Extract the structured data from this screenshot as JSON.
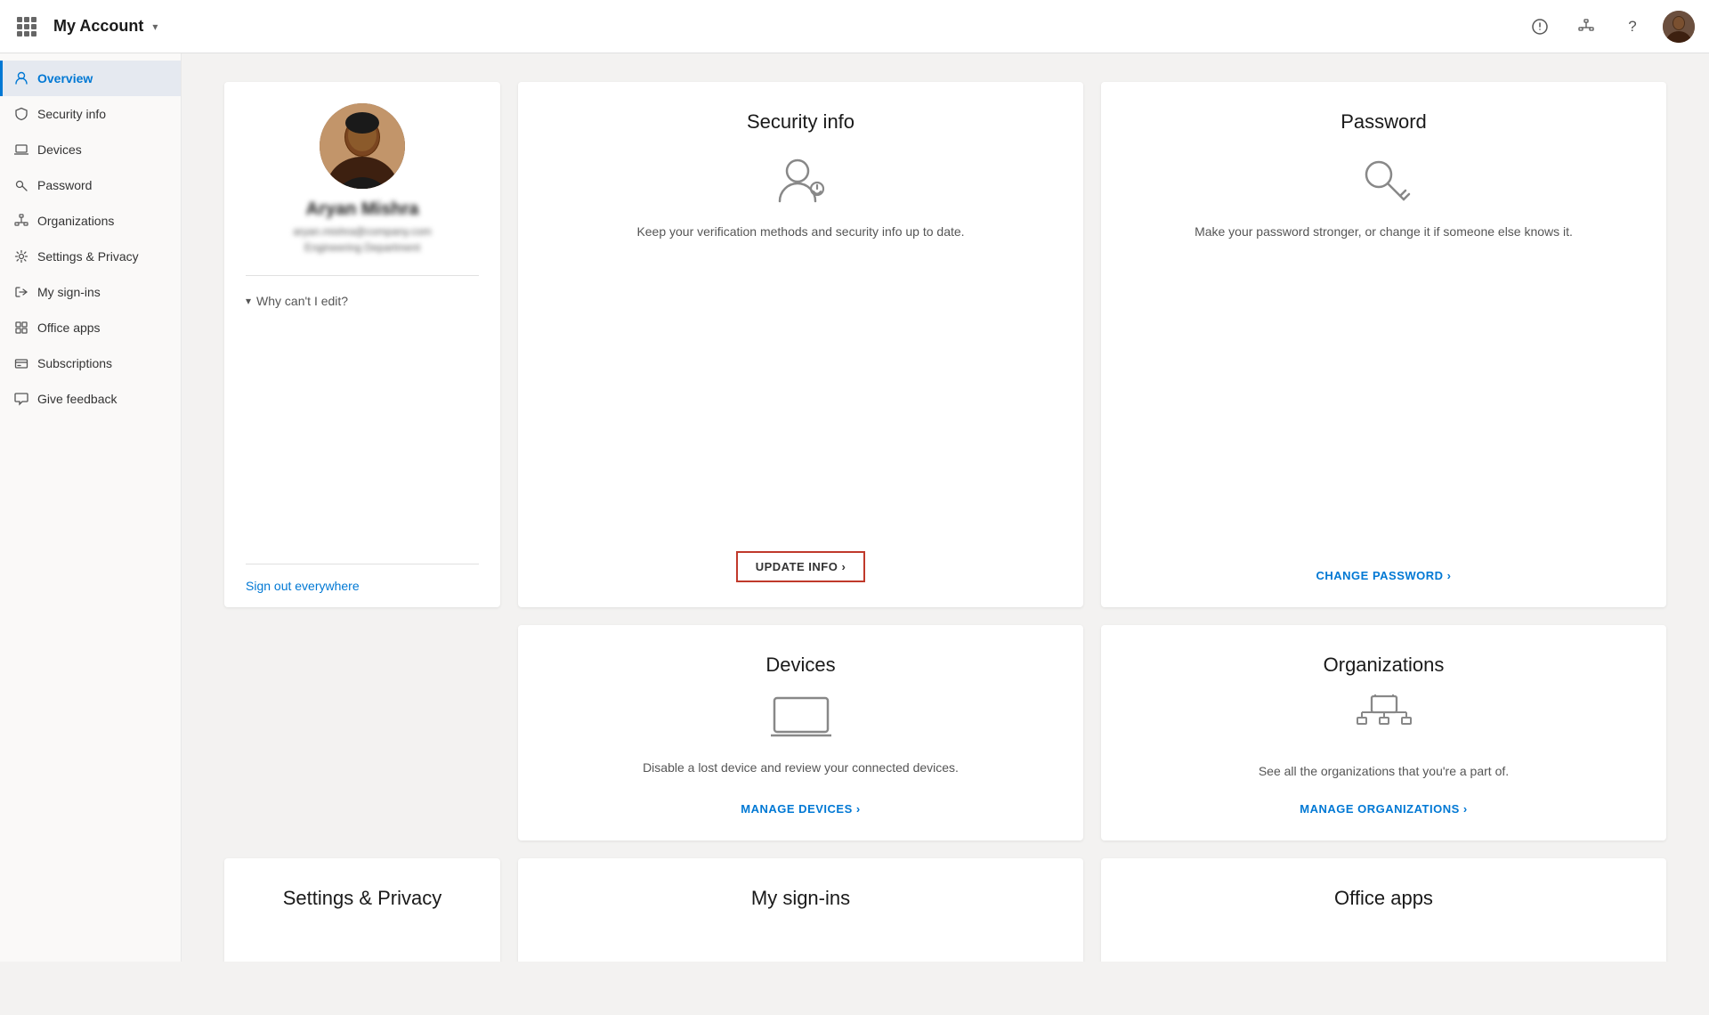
{
  "header": {
    "title": "My Account",
    "chevron": "▾"
  },
  "sidebar": {
    "items": [
      {
        "id": "overview",
        "label": "Overview",
        "icon": "person",
        "active": true
      },
      {
        "id": "security-info",
        "label": "Security info",
        "icon": "shield"
      },
      {
        "id": "devices",
        "label": "Devices",
        "icon": "laptop"
      },
      {
        "id": "password",
        "label": "Password",
        "icon": "key"
      },
      {
        "id": "organizations",
        "label": "Organizations",
        "icon": "org"
      },
      {
        "id": "settings-privacy",
        "label": "Settings & Privacy",
        "icon": "settings"
      },
      {
        "id": "my-sign-ins",
        "label": "My sign-ins",
        "icon": "signin"
      },
      {
        "id": "office-apps",
        "label": "Office apps",
        "icon": "office"
      },
      {
        "id": "subscriptions",
        "label": "Subscriptions",
        "icon": "subscriptions"
      },
      {
        "id": "give-feedback",
        "label": "Give feedback",
        "icon": "feedback"
      }
    ]
  },
  "profile": {
    "name": "Aryan Mishra",
    "email": "aryan.mishra@company.com",
    "dept": "Engineering Department",
    "why_edit": "Why can't I edit?",
    "sign_out": "Sign out everywhere"
  },
  "cards": {
    "security_info": {
      "title": "Security info",
      "desc": "Keep your verification methods and security info up to date.",
      "cta": "UPDATE INFO ›"
    },
    "password": {
      "title": "Password",
      "desc": "Make your password stronger, or change it if someone else knows it.",
      "cta": "CHANGE PASSWORD ›"
    },
    "devices": {
      "title": "Devices",
      "desc": "Disable a lost device and review your connected devices.",
      "cta": "MANAGE DEVICES ›"
    },
    "organizations": {
      "title": "Organizations",
      "desc": "See all the organizations that you're a part of.",
      "cta": "MANAGE ORGANIZATIONS ›"
    }
  },
  "bottom_cards": {
    "settings_privacy": {
      "title": "Settings & Privacy"
    },
    "my_sign_ins": {
      "title": "My sign-ins"
    },
    "office_apps": {
      "title": "Office apps"
    }
  }
}
